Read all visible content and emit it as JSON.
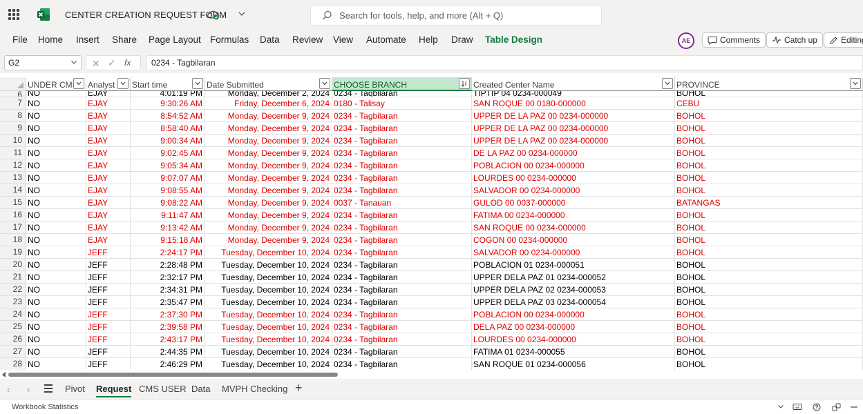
{
  "titlebar": {
    "doc_title": "CENTER CREATION REQUEST FORM",
    "search_placeholder": "Search for tools, help, and more (Alt + Q)"
  },
  "ribbon": {
    "tabs": [
      "File",
      "Home",
      "Insert",
      "Share",
      "Page Layout",
      "Formulas",
      "Data",
      "Review",
      "View",
      "Automate",
      "Help",
      "Draw",
      "Table Design"
    ],
    "avatar_initials": "AE",
    "comments_label": "Comments",
    "catchup_label": "Catch up",
    "editing_label": "Editing"
  },
  "formula_bar": {
    "name_box": "G2",
    "fx_label": "fx",
    "formula": "0234 - Tagbilaran"
  },
  "grid": {
    "headers": [
      "UNDER CMS",
      "Analyst",
      "Start time",
      "Date Submitted",
      "CHOOSE BRANCH",
      "Created Center Name",
      "PROVINCE"
    ],
    "partial_row": {
      "row_number": "6",
      "cells": [
        "NO",
        "EJAY",
        "4:01:19 PM",
        "Monday, December 2, 2024",
        "0234 - Tagbilaran",
        "TIPTIP 04 0234-000049",
        "BOHOL"
      ]
    },
    "rows": [
      {
        "n": "7",
        "red": true,
        "cells": [
          "NO",
          "EJAY",
          "9:30:26 AM",
          "Friday, December 6, 2024",
          "0180 - Talisay",
          "SAN ROQUE 00 0180-000000",
          "CEBU"
        ]
      },
      {
        "n": "8",
        "red": true,
        "cells": [
          "NO",
          "EJAY",
          "8:54:52 AM",
          "Monday, December 9, 2024",
          "0234 - Tagbilaran",
          "UPPER DE LA PAZ 00 0234-000000",
          "BOHOL"
        ]
      },
      {
        "n": "9",
        "red": true,
        "cells": [
          "NO",
          "EJAY",
          "8:58:40 AM",
          "Monday, December 9, 2024",
          "0234 - Tagbilaran",
          "UPPER DE LA PAZ 00 0234-000000",
          "BOHOL"
        ]
      },
      {
        "n": "10",
        "red": true,
        "cells": [
          "NO",
          "EJAY",
          "9:00:34 AM",
          "Monday, December 9, 2024",
          "0234 - Tagbilaran",
          "UPPER DE LA PAZ 00 0234-000000",
          "BOHOL"
        ]
      },
      {
        "n": "11",
        "red": true,
        "cells": [
          "NO",
          "EJAY",
          "9:02:45 AM",
          "Monday, December 9, 2024",
          "0234 - Tagbilaran",
          "DE LA PAZ 00 0234-000000",
          "BOHOL"
        ]
      },
      {
        "n": "12",
        "red": true,
        "cells": [
          "NO",
          "EJAY",
          "9:05:34 AM",
          "Monday, December 9, 2024",
          "0234 - Tagbilaran",
          "POBLACION 00 0234-000000",
          "BOHOL"
        ]
      },
      {
        "n": "13",
        "red": true,
        "cells": [
          "NO",
          "EJAY",
          "9:07:07 AM",
          "Monday, December 9, 2024",
          "0234 - Tagbilaran",
          "LOURDES 00 0234-000000",
          "BOHOL"
        ]
      },
      {
        "n": "14",
        "red": true,
        "cells": [
          "NO",
          "EJAY",
          "9:08:55 AM",
          "Monday, December 9, 2024",
          "0234 - Tagbilaran",
          "SALVADOR 00 0234-000000",
          "BOHOL"
        ]
      },
      {
        "n": "15",
        "red": true,
        "cells": [
          "NO",
          "EJAY",
          "9:08:22 AM",
          "Monday, December 9, 2024",
          "0037 - Tanauan",
          "GULOD 00 0037-000000",
          "BATANGAS"
        ]
      },
      {
        "n": "16",
        "red": true,
        "cells": [
          "NO",
          "EJAY",
          "9:11:47 AM",
          "Monday, December 9, 2024",
          "0234 - Tagbilaran",
          "FATIMA 00 0234-000000",
          "BOHOL"
        ]
      },
      {
        "n": "17",
        "red": true,
        "cells": [
          "NO",
          "EJAY",
          "9:13:42 AM",
          "Monday, December 9, 2024",
          "0234 - Tagbilaran",
          "SAN ROQUE 00 0234-000000",
          "BOHOL"
        ]
      },
      {
        "n": "18",
        "red": true,
        "cells": [
          "NO",
          "EJAY",
          "9:15:18 AM",
          "Monday, December 9, 2024",
          "0234 - Tagbilaran",
          "COGON 00 0234-000000",
          "BOHOL"
        ]
      },
      {
        "n": "19",
        "red": true,
        "cells": [
          "NO",
          "JEFF",
          "2:24:17 PM",
          "Tuesday, December 10, 2024",
          "0234 - Tagbilaran",
          "SALVADOR 00 0234-000000",
          "BOHOL"
        ]
      },
      {
        "n": "20",
        "red": false,
        "cells": [
          "NO",
          "JEFF",
          "2:28:48 PM",
          "Tuesday, December 10, 2024",
          "0234 - Tagbilaran",
          "POBLACION 01 0234-000051",
          "BOHOL"
        ]
      },
      {
        "n": "21",
        "red": false,
        "cells": [
          "NO",
          "JEFF",
          "2:32:17 PM",
          "Tuesday, December 10, 2024",
          "0234 - Tagbilaran",
          "UPPER DELA PAZ 01 0234-000052",
          "BOHOL"
        ]
      },
      {
        "n": "22",
        "red": false,
        "cells": [
          "NO",
          "JEFF",
          "2:34:31 PM",
          "Tuesday, December 10, 2024",
          "0234 - Tagbilaran",
          "UPPER DELA PAZ 02 0234-000053",
          "BOHOL"
        ]
      },
      {
        "n": "23",
        "red": false,
        "cells": [
          "NO",
          "JEFF",
          "2:35:47 PM",
          "Tuesday, December 10, 2024",
          "0234 - Tagbilaran",
          "UPPER DELA PAZ 03 0234-000054",
          "BOHOL"
        ]
      },
      {
        "n": "24",
        "red": true,
        "cells": [
          "NO",
          "JEFF",
          "2:37:30 PM",
          "Tuesday, December 10, 2024",
          "0234 - Tagbilaran",
          "POBLACION 00 0234-000000",
          "BOHOL"
        ]
      },
      {
        "n": "25",
        "red": true,
        "cells": [
          "NO",
          "JEFF",
          "2:39:58 PM",
          "Tuesday, December 10, 2024",
          "0234 - Tagbilaran",
          "DELA PAZ 00 0234-000000",
          "BOHOL"
        ]
      },
      {
        "n": "26",
        "red": true,
        "cells": [
          "NO",
          "JEFF",
          "2:43:17 PM",
          "Tuesday, December 10, 2024",
          "0234 - Tagbilaran",
          "LOURDES 00 0234-000000",
          "BOHOL"
        ]
      },
      {
        "n": "27",
        "red": false,
        "cells": [
          "NO",
          "JEFF",
          "2:44:35 PM",
          "Tuesday, December 10, 2024",
          "0234 - Tagbilaran",
          "FATIMA 01 0234-000055",
          "BOHOL"
        ]
      },
      {
        "n": "28",
        "red": false,
        "cells": [
          "NO",
          "JEFF",
          "2:46:29 PM",
          "Tuesday, December 10, 2024",
          "0234 - Tagbilaran",
          "SAN ROQUE 01 0234-000056",
          "BOHOL"
        ]
      }
    ]
  },
  "sheet_tabs": {
    "tabs": [
      "Pivot",
      "Request",
      "CMS USER",
      "Data",
      "MVPH Checking"
    ],
    "active": "Request"
  },
  "status_bar": {
    "text": "Workbook Statistics"
  },
  "colors": {
    "excel_green": "#107c41",
    "red_text": "#e00000",
    "selected_header": "#c4e8cf"
  }
}
